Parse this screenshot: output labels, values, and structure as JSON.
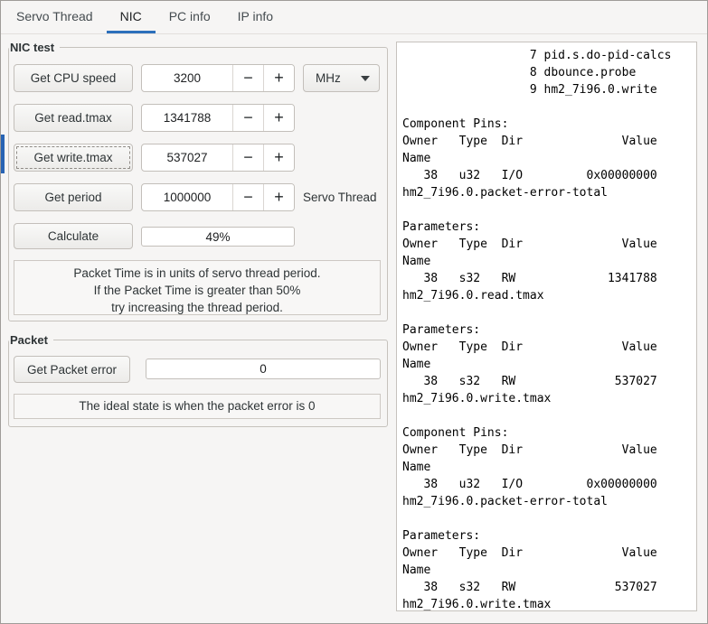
{
  "colors": {
    "accent": "#2c6fbb",
    "focus_stripe": "#2864b4"
  },
  "tabs": [
    {
      "label": "Servo Thread",
      "active": false
    },
    {
      "label": "NIC",
      "active": true
    },
    {
      "label": "PC info",
      "active": false
    },
    {
      "label": "IP info",
      "active": false
    }
  ],
  "glyphs": {
    "minus": "−",
    "plus": "+"
  },
  "nic_test": {
    "legend": "NIC test",
    "rows": [
      {
        "button": "Get CPU speed",
        "value": "3200",
        "unit": "MHz"
      },
      {
        "button": "Get read.tmax",
        "value": "1341788"
      },
      {
        "button": "Get write.tmax",
        "value": "537027"
      },
      {
        "button": "Get period",
        "value": "1000000",
        "side_label": "Servo Thread"
      }
    ],
    "calculate_button": "Calculate",
    "progress": "49%",
    "note": "Packet Time is in units of servo thread period.\nIf the Packet Time is greater than 50%\ntry increasing the thread period."
  },
  "packet": {
    "legend": "Packet",
    "button": "Get Packet error",
    "value": "0",
    "note": "The ideal state is when the packet error is 0"
  },
  "console": {
    "text": "                  7 pid.s.do-pid-calcs\n                  8 dbounce.probe\n                  9 hm2_7i96.0.write\n\nComponent Pins:\nOwner   Type  Dir              Value\nName\n   38   u32   I/O         0x00000000\nhm2_7i96.0.packet-error-total\n\nParameters:\nOwner   Type  Dir              Value\nName\n   38   s32   RW             1341788\nhm2_7i96.0.read.tmax\n\nParameters:\nOwner   Type  Dir              Value\nName\n   38   s32   RW              537027\nhm2_7i96.0.write.tmax\n\nComponent Pins:\nOwner   Type  Dir              Value\nName\n   38   u32   I/O         0x00000000\nhm2_7i96.0.packet-error-total\n\nParameters:\nOwner   Type  Dir              Value\nName\n   38   s32   RW              537027\nhm2_7i96.0.write.tmax"
  }
}
